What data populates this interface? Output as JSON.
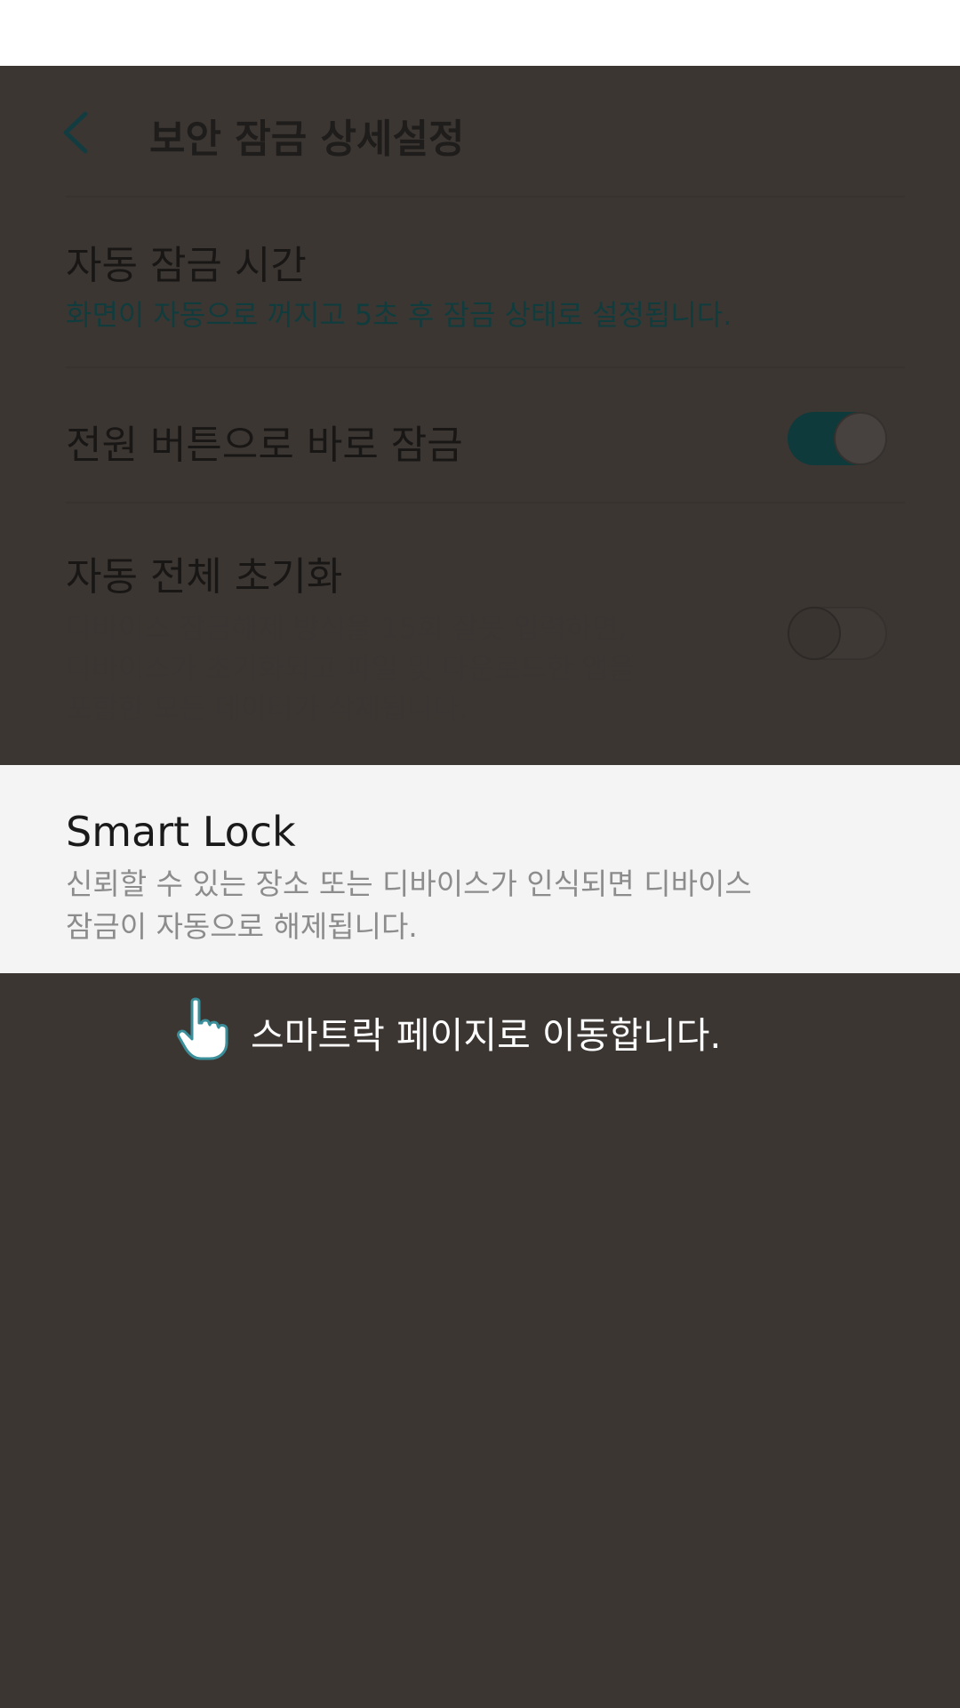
{
  "header": {
    "title": "보안 잠금 상세설정",
    "back_icon": "chevron-left-icon"
  },
  "settings": [
    {
      "title": "자동 잠금 시간",
      "description": "화면이 자동으로 꺼지고 5초 후 잠금 상태로 설정됩니다."
    },
    {
      "title": "전원 버튼으로 바로 잠금",
      "toggle": "on"
    },
    {
      "title": "자동 전체 초기화",
      "description_lines": [
        "디바이스 잠금해제 방식을 15회 잘못 입력하면,",
        "디바이스가 초기화되고 파일 및 다운로드한 앱을",
        "포함한 모든 데이터가 삭제됩니다."
      ],
      "toggle": "off"
    }
  ],
  "highlight": {
    "title": "Smart Lock",
    "description_lines": [
      "신뢰할 수 있는 장소 또는 디바이스가 인식되면 디바이스",
      "잠금이 자동으로 해제됩니다."
    ]
  },
  "hint": {
    "icon": "hand-pointer-icon",
    "text": "스마트락 페이지로 이동합니다."
  },
  "colors": {
    "overlay": "#3c3632",
    "accent_dim": "#113c3d",
    "highlight_bg": "#f4f4f4"
  }
}
